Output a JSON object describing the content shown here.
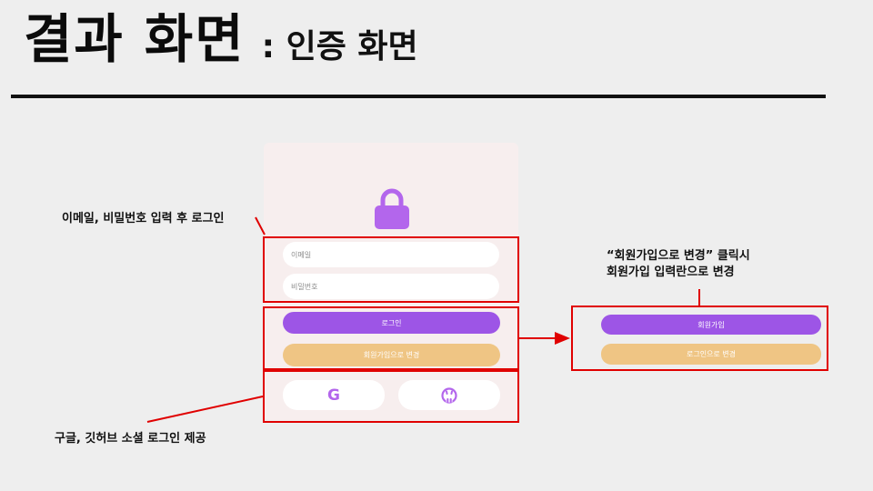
{
  "slide": {
    "title_main": "결과 화면",
    "title_sub": ": 인증 화면"
  },
  "auth": {
    "email_placeholder": "이메일",
    "password_placeholder": "비밀번호",
    "login_label": "로그인",
    "switch_to_signup_label": "회원가입으로 변경",
    "google_label": "G"
  },
  "signup_preview": {
    "signup_label": "회원가입",
    "switch_to_login_label": "로그인으로 변경"
  },
  "annotations": {
    "login_note": "이메일, 비밀번호 입력 후 로그인",
    "switch_note_line1": "“회원가입으로 변경” 클릭시",
    "switch_note_line2": "회원가입 입력란으로 변경",
    "social_note": "구글, 깃허브 소셜 로그인 제공"
  },
  "colors": {
    "purple": "#9d55e6",
    "orange": "#efc584",
    "highlight_red": "#e00000",
    "card_bg": "#f7eeee",
    "lock": "#b366ec"
  },
  "icons": {
    "lock": "lock-icon",
    "google": "google-icon",
    "github": "github-icon"
  }
}
